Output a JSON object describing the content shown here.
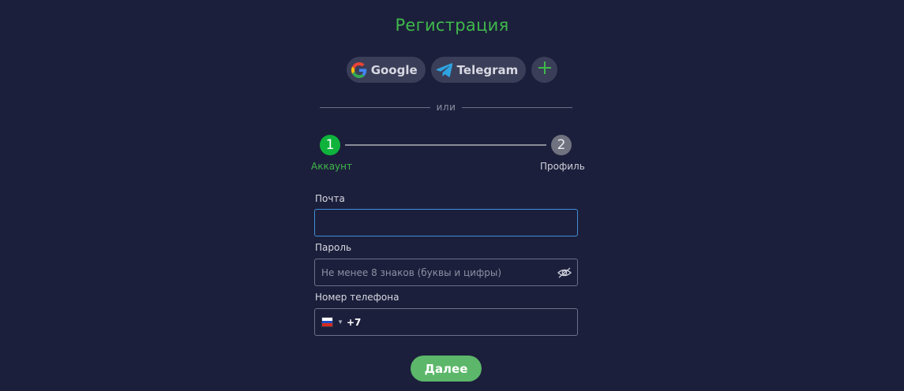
{
  "page": {
    "title": "Регистрация"
  },
  "social": {
    "google_label": "Google",
    "telegram_label": "Telegram"
  },
  "divider_text": "или",
  "steps": [
    {
      "number": "1",
      "label": "Аккаунт",
      "state": "active"
    },
    {
      "number": "2",
      "label": "Профиль",
      "state": "inactive"
    }
  ],
  "form": {
    "email": {
      "label": "Почта",
      "value": "",
      "placeholder": ""
    },
    "password": {
      "label": "Пароль",
      "value": "",
      "placeholder": "Не менее 8 знаков (буквы и цифры)"
    },
    "phone": {
      "label": "Номер телефона",
      "country_icon": "russia-flag-icon",
      "code": "+7",
      "value": ""
    }
  },
  "submit_label": "Далее",
  "colors": {
    "background": "#1c1f3b",
    "accent_green": "#3fb84b",
    "step_active": "#0fb33c",
    "button_green": "#5cb76a",
    "focus_border": "#3f8fd8"
  }
}
